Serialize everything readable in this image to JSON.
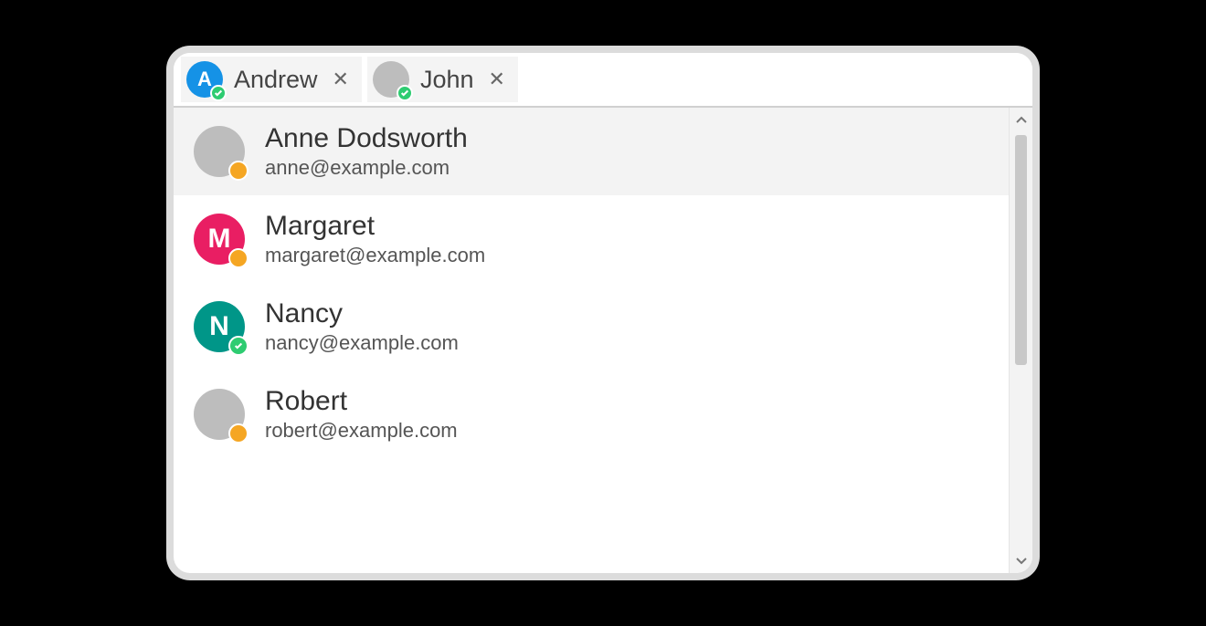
{
  "colors": {
    "blue": "#1592e6",
    "grey": "#bdbdbd",
    "pink": "#e91e63",
    "teal": "#009688",
    "online": "#2ecc71",
    "away": "#f5a623"
  },
  "tokens": [
    {
      "label": "Andrew",
      "initial": "A",
      "avatar_bg": "#1592e6",
      "status": "online"
    },
    {
      "label": "John",
      "initial": "",
      "avatar_bg": "#bdbdbd",
      "status": "online"
    }
  ],
  "list": [
    {
      "name": "Anne Dodsworth",
      "email": "anne@example.com",
      "initial": "",
      "avatar_bg": "#bdbdbd",
      "status": "away",
      "highlight": true
    },
    {
      "name": "Margaret",
      "email": "margaret@example.com",
      "initial": "M",
      "avatar_bg": "#e91e63",
      "status": "away",
      "highlight": false
    },
    {
      "name": "Nancy",
      "email": "nancy@example.com",
      "initial": "N",
      "avatar_bg": "#009688",
      "status": "online",
      "highlight": false
    },
    {
      "name": "Robert",
      "email": "robert@example.com",
      "initial": "",
      "avatar_bg": "#bdbdbd",
      "status": "away",
      "highlight": false
    }
  ],
  "close_glyph": "✕"
}
